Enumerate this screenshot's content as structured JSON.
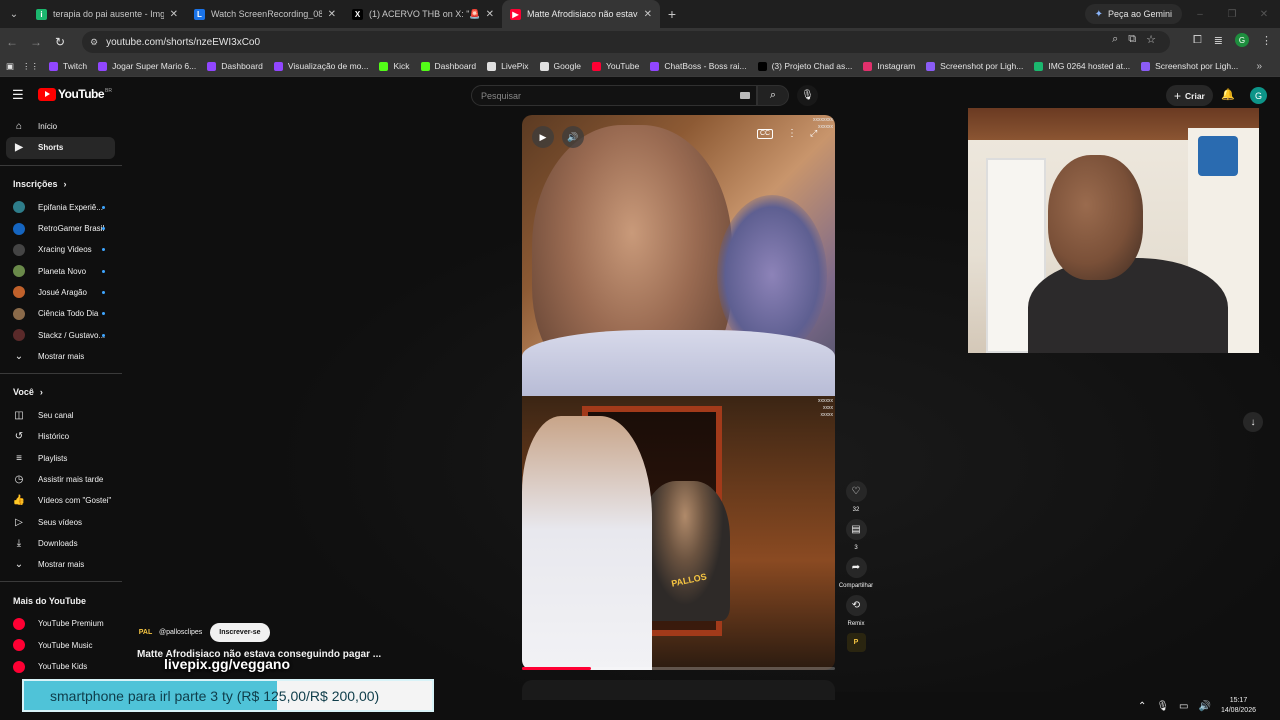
{
  "tabs": [
    {
      "title": "terapia do pai ausente - Imgur",
      "color": "#1bb76e",
      "glyph": "i"
    },
    {
      "title": "Watch ScreenRecording_08-01",
      "color": "#1a73e8",
      "glyph": "L"
    },
    {
      "title": "(1) ACERVO THB on X: \"🚨URG",
      "color": "#000000",
      "glyph": "X"
    },
    {
      "title": "Matte Afrodisiaco não estava c",
      "color": "#ff0033",
      "glyph": "▶",
      "active": true
    }
  ],
  "gemini_label": "Peça ao Gemini",
  "url": "youtube.com/shorts/nzeEWI3xCo0",
  "bookmarks": [
    {
      "label": "Twitch",
      "color": "#9146ff"
    },
    {
      "label": "Jogar Super Mario 6...",
      "color": "#9146ff"
    },
    {
      "label": "Dashboard",
      "color": "#9146ff"
    },
    {
      "label": "Visualização de mo...",
      "color": "#9146ff"
    },
    {
      "label": "Kick",
      "color": "#53fc18"
    },
    {
      "label": "Dashboard",
      "color": "#53fc18"
    },
    {
      "label": "LivePix",
      "color": "#e0e0e0"
    },
    {
      "label": "Google",
      "color": "#e0e0e0"
    },
    {
      "label": "YouTube",
      "color": "#ff0033"
    },
    {
      "label": "ChatBoss - Boss rai...",
      "color": "#9146ff"
    },
    {
      "label": "(3) Projeto Chad as...",
      "color": "#000000"
    },
    {
      "label": "Instagram",
      "color": "#e1306c"
    },
    {
      "label": "Screenshot por Ligh...",
      "color": "#8b5cf6"
    },
    {
      "label": "IMG 0264 hosted at...",
      "color": "#1bb76e"
    },
    {
      "label": "Screenshot por Ligh...",
      "color": "#8b5cf6"
    }
  ],
  "yt": {
    "logo": "YouTube",
    "country": "BR",
    "search_placeholder": "Pesquisar",
    "create_label": "Criar",
    "avatar_letter": "G"
  },
  "sidebar": {
    "main": [
      {
        "label": "Início",
        "icon": "⌂"
      },
      {
        "label": "Shorts",
        "icon": "▶",
        "active": true
      }
    ],
    "subs_title": "Inscrições",
    "subs": [
      {
        "label": "Epifania Experiê...",
        "color": "#2e7d8a"
      },
      {
        "label": "RetroGamer Brasil",
        "color": "#1565c0"
      },
      {
        "label": "Xracing Videos",
        "color": "#444444"
      },
      {
        "label": "Planeta Novo",
        "color": "#6a8a4a"
      },
      {
        "label": "Josué Aragão",
        "color": "#c0612b"
      },
      {
        "label": "Ciência Todo Dia",
        "color": "#8a6a4a"
      },
      {
        "label": "Stackz / Gustavo...",
        "color": "#5a2a2a"
      }
    ],
    "subs_more": "Mostrar mais",
    "you_title": "Você",
    "you": [
      {
        "label": "Seu canal",
        "icon": "◫"
      },
      {
        "label": "Histórico",
        "icon": "↺"
      },
      {
        "label": "Playlists",
        "icon": "≡"
      },
      {
        "label": "Assistir mais tarde",
        "icon": "◷"
      },
      {
        "label": "Vídeos com \"Gostei\"",
        "icon": "👍"
      },
      {
        "label": "Seus vídeos",
        "icon": "▷"
      },
      {
        "label": "Downloads",
        "icon": "⤓"
      }
    ],
    "you_more": "Mostrar mais",
    "more_title": "Mais do YouTube",
    "more": [
      {
        "label": "YouTube Premium",
        "color": "#ff0033"
      },
      {
        "label": "YouTube Music",
        "color": "#ff0033"
      },
      {
        "label": "YouTube Kids",
        "color": "#ff0033"
      }
    ]
  },
  "short": {
    "channel": "@pallosclipes",
    "subscribe_label": "Inscrever-se",
    "title": "Matte Afrodisiaco não estava conseguindo pagar ...",
    "likes": "32",
    "comments": "3",
    "share_label": "Compartilhar",
    "remix_label": "Remix",
    "progress": 0.22
  },
  "overlay": {
    "url_text": "livepix.gg/veggano",
    "donation_text": "smartphone para irl parte 3 ty (R$ 125,00/R$ 200,00)"
  },
  "clock": {
    "time": "15:17",
    "date": "14/08/2026"
  }
}
